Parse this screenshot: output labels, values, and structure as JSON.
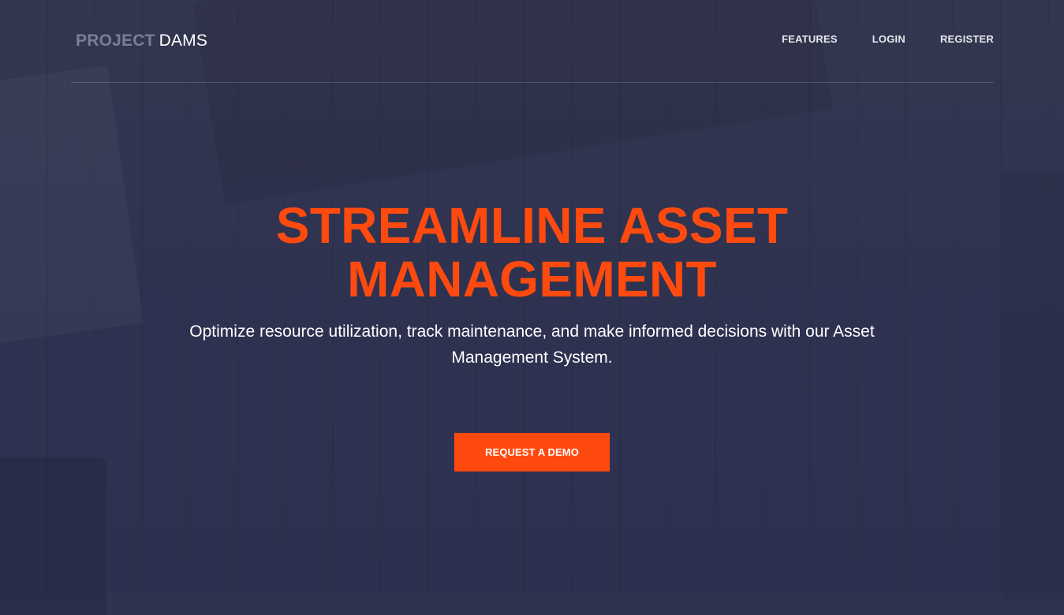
{
  "brand": {
    "part1": "PROJECT",
    "part2": "DAMS"
  },
  "nav": {
    "links": [
      {
        "label": "FEATURES"
      },
      {
        "label": "LOGIN"
      },
      {
        "label": "REGISTER"
      }
    ]
  },
  "hero": {
    "title": "STREAMLINE ASSET MANAGEMENT",
    "subtitle": "Optimize resource utilization, track maintenance, and make informed decisions with our Asset Management System.",
    "cta_label": "REQUEST A DEMO"
  },
  "colors": {
    "background": "#2f3350",
    "accent": "#ff4a0f",
    "brand_muted": "#7b7f93"
  }
}
